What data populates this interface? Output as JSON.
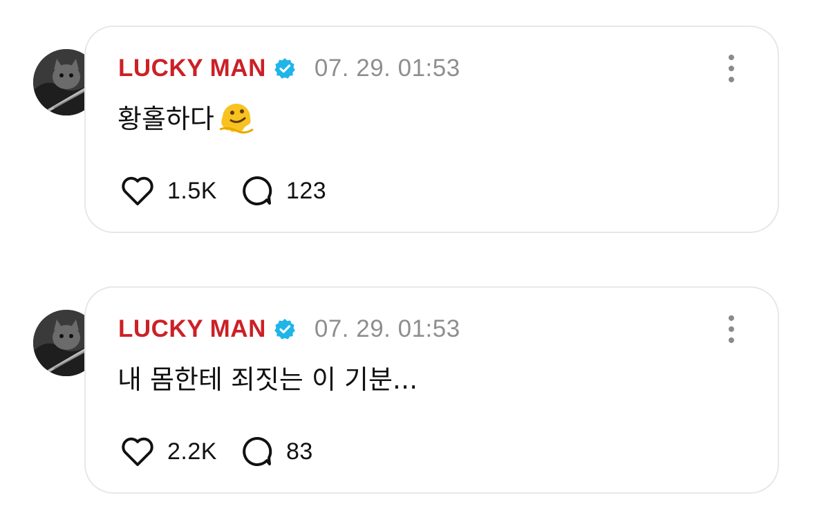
{
  "posts": [
    {
      "author": "LUCKY MAN",
      "verified_icon": "verified-badge-icon",
      "timestamp": "07. 29. 01:53",
      "text": "황홀하다",
      "emoji": "melting-face-emoji",
      "likes": "1.5K",
      "comments": "123"
    },
    {
      "author": "LUCKY MAN",
      "verified_icon": "verified-badge-icon",
      "timestamp": "07. 29. 01:53",
      "text": "내 몸한테 죄짓는 이 기분...",
      "likes": "2.2K",
      "comments": "83"
    }
  ],
  "colors": {
    "author": "#cc2026",
    "verified": "#1fb5e8",
    "timestamp": "#8e8e8e",
    "border": "#e7e7e7"
  }
}
